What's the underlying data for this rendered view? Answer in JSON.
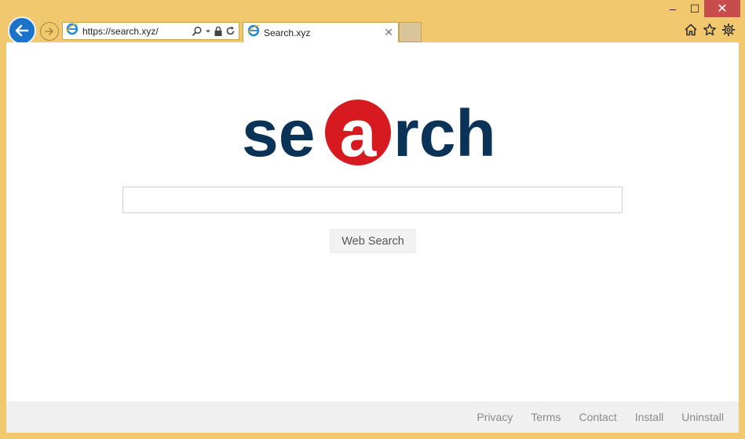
{
  "window": {
    "minimize": "–",
    "maximize": "☐",
    "close": "✕"
  },
  "address": {
    "url": "https://search.xyz/"
  },
  "tab": {
    "title": "Search.xyz",
    "close": "✕"
  },
  "page": {
    "logo_text_left": "se",
    "logo_text_circle": "a",
    "logo_text_right": "rch",
    "search_button": "Web Search",
    "search_input_value": "",
    "colors": {
      "logo_blue": "#0b3358",
      "logo_red": "#d71920"
    }
  },
  "footer": {
    "links": [
      "Privacy",
      "Terms",
      "Contact",
      "Install",
      "Uninstall"
    ]
  }
}
